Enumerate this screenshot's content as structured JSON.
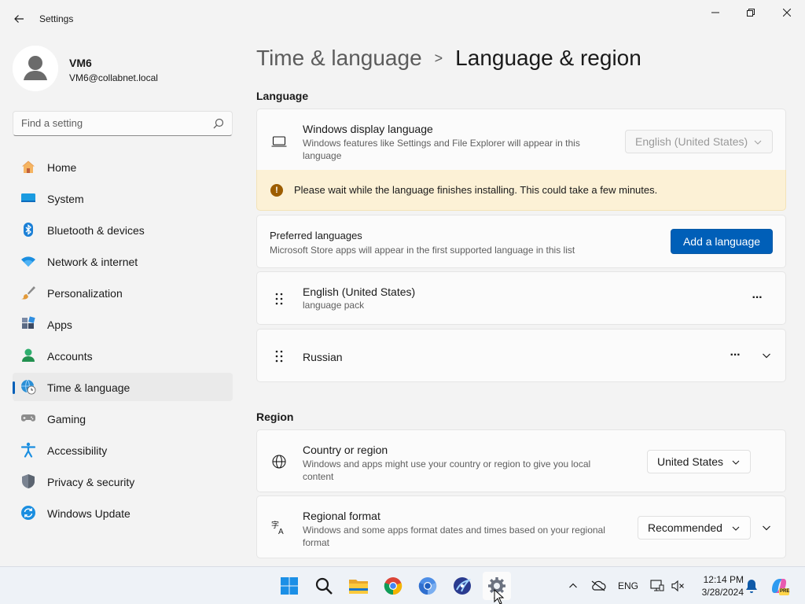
{
  "window": {
    "title": "Settings"
  },
  "profile": {
    "name": "VM6",
    "email": "VM6@collabnet.local"
  },
  "search": {
    "placeholder": "Find a setting"
  },
  "sidebar": {
    "items": [
      {
        "label": "Home",
        "icon": "home-icon"
      },
      {
        "label": "System",
        "icon": "system-icon"
      },
      {
        "label": "Bluetooth & devices",
        "icon": "bluetooth-icon"
      },
      {
        "label": "Network & internet",
        "icon": "wifi-icon"
      },
      {
        "label": "Personalization",
        "icon": "brush-icon"
      },
      {
        "label": "Apps",
        "icon": "apps-icon"
      },
      {
        "label": "Accounts",
        "icon": "accounts-icon"
      },
      {
        "label": "Time & language",
        "icon": "globe-clock-icon",
        "selected": true
      },
      {
        "label": "Gaming",
        "icon": "gamepad-icon"
      },
      {
        "label": "Accessibility",
        "icon": "accessibility-icon"
      },
      {
        "label": "Privacy & security",
        "icon": "shield-icon"
      },
      {
        "label": "Windows Update",
        "icon": "update-icon"
      }
    ]
  },
  "breadcrumb": {
    "parent": "Time & language",
    "separator": ">",
    "current": "Language & region"
  },
  "language": {
    "section_title": "Language",
    "display_language": {
      "title": "Windows display language",
      "description": "Windows features like Settings and File Explorer will appear in this language",
      "value": "English (United States)"
    },
    "warning": {
      "text": "Please wait while the language finishes installing. This could take a few minutes.",
      "icon_glyph": "!"
    },
    "preferred": {
      "title": "Preferred languages",
      "description": "Microsoft Store apps will appear in the first supported language in this list",
      "add_button": "Add a language"
    },
    "languages": [
      {
        "name": "English (United States)",
        "detail": "language pack"
      },
      {
        "name": "Russian",
        "detail": ""
      }
    ],
    "more_glyph": "···"
  },
  "region": {
    "section_title": "Region",
    "country": {
      "title": "Country or region",
      "description": "Windows and apps might use your country or region to give you local content",
      "value": "United States"
    },
    "format": {
      "title": "Regional format",
      "description": "Windows and some apps format dates and times based on your regional format",
      "value": "Recommended"
    }
  },
  "taskbar": {
    "tray": {
      "lang": "ENG",
      "time": "12:14 PM",
      "date": "3/28/2024",
      "copilot_badge": "PRE"
    }
  },
  "colors": {
    "accent": "#005fb8",
    "warning_bg": "#fcf1d6",
    "warning_icon": "#9d5d00"
  }
}
